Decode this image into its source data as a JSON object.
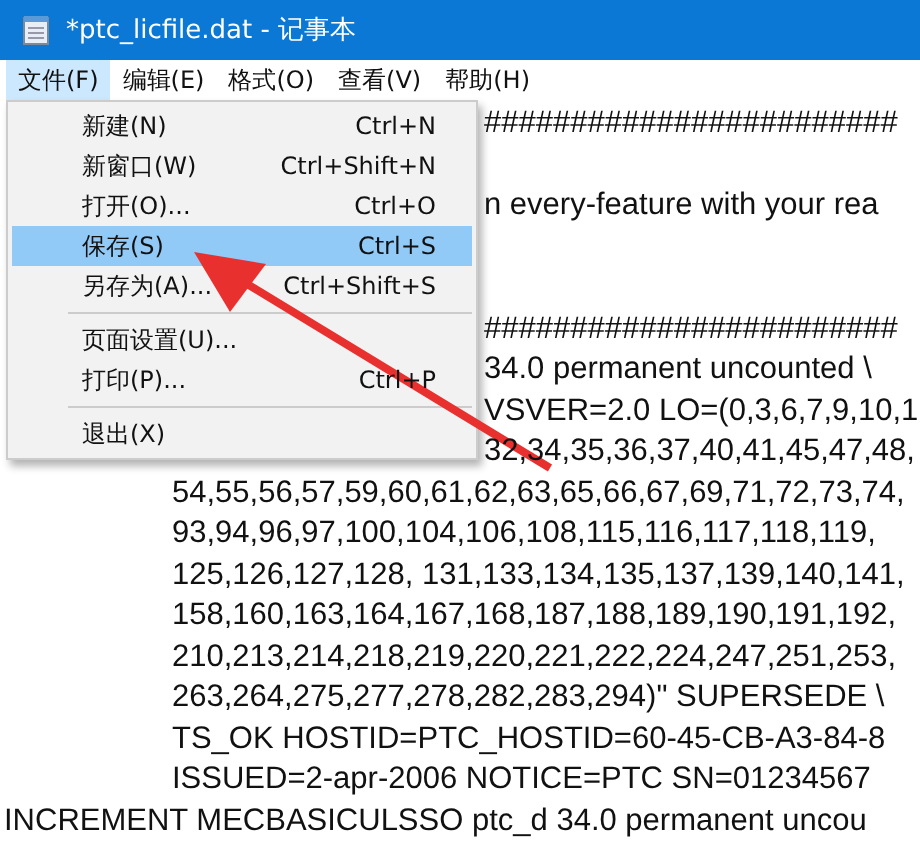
{
  "window": {
    "title": "*ptc_licfile.dat - 记事本"
  },
  "menu_bar": [
    {
      "label": "文件(F)",
      "selected": true
    },
    {
      "label": "编辑(E)",
      "selected": false
    },
    {
      "label": "格式(O)",
      "selected": false
    },
    {
      "label": "查看(V)",
      "selected": false
    },
    {
      "label": "帮助(H)",
      "selected": false
    }
  ],
  "file_menu": [
    {
      "kind": "item",
      "label": "新建(N)",
      "shortcut": "Ctrl+N",
      "selected": false
    },
    {
      "kind": "item",
      "label": "新窗口(W)",
      "shortcut": "Ctrl+Shift+N",
      "selected": false
    },
    {
      "kind": "item",
      "label": "打开(O)...",
      "shortcut": "Ctrl+O",
      "selected": false
    },
    {
      "kind": "item",
      "label": "保存(S)",
      "shortcut": "Ctrl+S",
      "selected": true
    },
    {
      "kind": "item",
      "label": "另存为(A)...",
      "shortcut": "Ctrl+Shift+S",
      "selected": false
    },
    {
      "kind": "separator"
    },
    {
      "kind": "item",
      "label": "页面设置(U)...",
      "selected": false
    },
    {
      "kind": "item",
      "label": "打印(P)...",
      "shortcut": "Ctrl+P",
      "selected": false
    },
    {
      "kind": "separator"
    },
    {
      "kind": "item",
      "label": "退出(X)",
      "selected": false
    }
  ],
  "editor_lines": [
    {
      "kind": "behind",
      "text": "########################"
    },
    {
      "kind": "blank"
    },
    {
      "kind": "behind",
      "text": "n every-feature with your rea"
    },
    {
      "kind": "blank"
    },
    {
      "kind": "blank"
    },
    {
      "kind": "behind",
      "text": "########################"
    },
    {
      "kind": "behind",
      "text": "34.0 permanent uncounted \\"
    },
    {
      "kind": "behind",
      "text": "VSVER=2.0 LO=(0,3,6,7,9,10,1"
    },
    {
      "kind": "behind",
      "text": "32,34,35,36,37,40,41,45,47,48,"
    },
    {
      "kind": "indented",
      "text": "54,55,56,57,59,60,61,62,63,65,66,67,69,71,72,73,74,"
    },
    {
      "kind": "indented",
      "text": "93,94,96,97,100,104,106,108,115,116,117,118,119,"
    },
    {
      "kind": "indented",
      "text": "125,126,127,128, 131,133,134,135,137,139,140,141,"
    },
    {
      "kind": "indented",
      "text": "158,160,163,164,167,168,187,188,189,190,191,192,"
    },
    {
      "kind": "indented",
      "text": "210,213,214,218,219,220,221,222,224,247,251,253,"
    },
    {
      "kind": "indented",
      "text": "263,264,275,277,278,282,283,294)\" SUPERSEDE \\"
    },
    {
      "kind": "indented",
      "text": "TS_OK HOSTID=PTC_HOSTID=60-45-CB-A3-84-8"
    },
    {
      "kind": "indented",
      "text": "ISSUED=2-apr-2006 NOTICE=PTC SN=01234567"
    },
    {
      "kind": "full",
      "text": "INCREMENT MECBASICULSSO ptc_d 34.0 permanent uncou"
    }
  ]
}
